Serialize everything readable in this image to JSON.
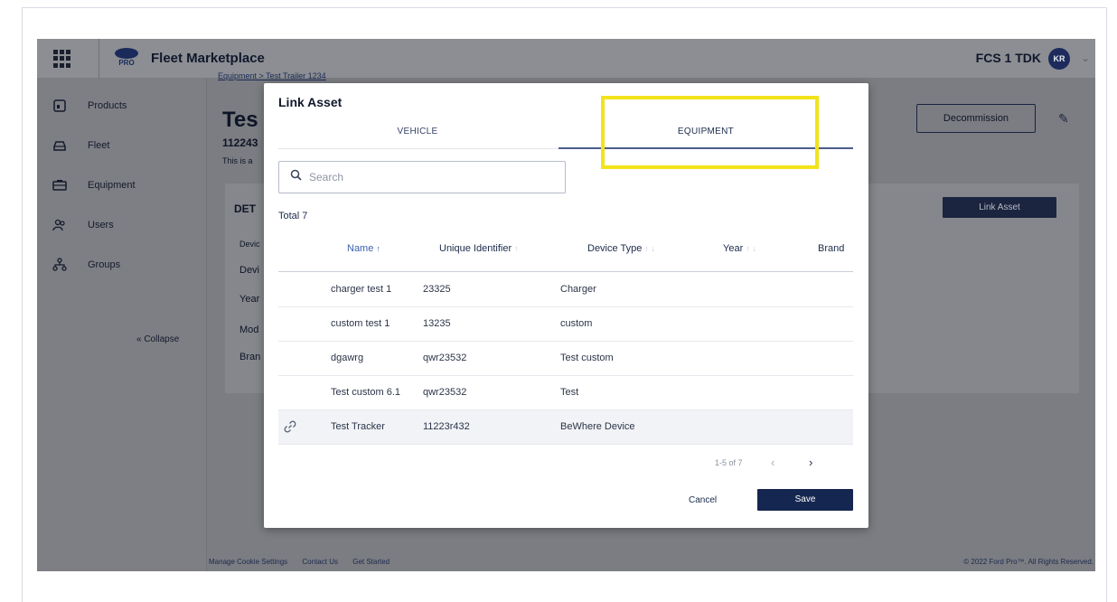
{
  "app": {
    "title": "Fleet Marketplace",
    "logo_text": "PRO",
    "org": "FCS 1 TDK",
    "avatar": "KR"
  },
  "sidebar": {
    "items": [
      {
        "label": "Products",
        "icon": "products-icon"
      },
      {
        "label": "Fleet",
        "icon": "car-icon"
      },
      {
        "label": "Equipment",
        "icon": "trailer-icon"
      },
      {
        "label": "Users",
        "icon": "users-icon"
      },
      {
        "label": "Groups",
        "icon": "groups-icon"
      }
    ],
    "collapse": "« Collapse"
  },
  "background": {
    "breadcrumb": "Equipment  >  Test Trailer 1234",
    "title": "Tes",
    "subtitle": "112243",
    "description": "This is a",
    "details_heading": "DET",
    "labels": [
      "Devic",
      "Devi",
      "Year",
      "Mod",
      "Bran"
    ],
    "decommission": "Decommission",
    "link_asset": "Link Asset",
    "footer": [
      "Manage Cookie Settings",
      "Contact Us",
      "Get Started"
    ],
    "copyright": "© 2022 Ford Pro™. All Rights Reserved."
  },
  "modal": {
    "title": "Link Asset",
    "tabs": [
      "VEHICLE",
      "EQUIPMENT"
    ],
    "active_tab": "EQUIPMENT",
    "search_placeholder": "Search",
    "total": "Total 7",
    "columns": [
      "Name",
      "Unique Identifier",
      "Device Type",
      "Year",
      "Brand"
    ],
    "rows": [
      {
        "name": "charger test 1",
        "id": "23325",
        "type": "Charger",
        "year": "",
        "brand": "",
        "linked": false
      },
      {
        "name": "custom test 1",
        "id": "13235",
        "type": "custom",
        "year": "",
        "brand": "",
        "linked": false
      },
      {
        "name": "dgawrg",
        "id": "qwr23532",
        "type": "Test custom",
        "year": "",
        "brand": "",
        "linked": false
      },
      {
        "name": "Test custom 6.1",
        "id": "qwr23532",
        "type": "Test",
        "year": "",
        "brand": "",
        "linked": false
      },
      {
        "name": "Test Tracker",
        "id": "11223r432",
        "type": "BeWhere Device",
        "year": "",
        "brand": "",
        "linked": true
      }
    ],
    "pager": "1-5 of 7",
    "cancel": "Cancel",
    "save": "Save"
  },
  "colors": {
    "accent": "#152650",
    "highlight": "#f2e31a",
    "overlay": "#7b7d82"
  }
}
